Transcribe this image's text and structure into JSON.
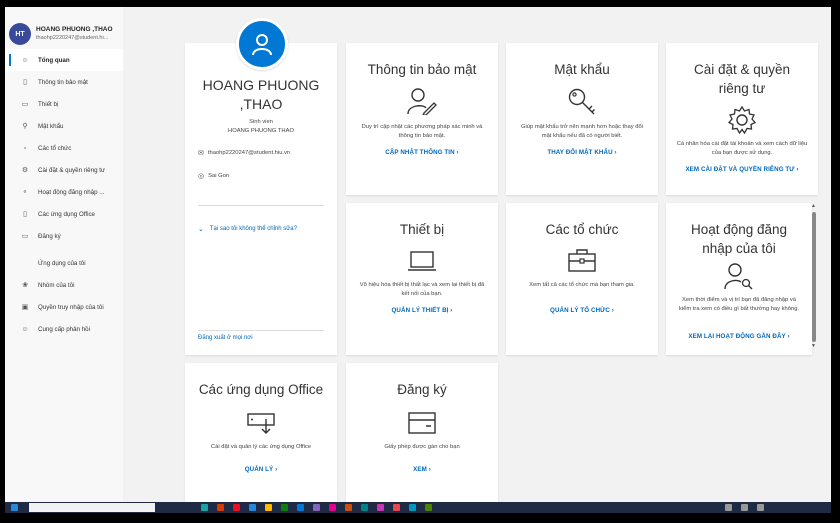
{
  "profile": {
    "avatar_initials": "HT",
    "name": "HOANG PHUONG ,THAO",
    "email_short": "thaohp2220247@student.hi...",
    "name_line1": "HOANG PHUONG",
    "name_line2": ",THAO",
    "role": "Sinh vien",
    "role_name": "HOANG PHUONG THAO",
    "email": "thaohp2220247@student.hiu.vn",
    "location": "Sai Gon",
    "why_cant_edit": "Tại sao tôi không thể chỉnh sửa?",
    "sign_out_everywhere": "Đăng xuất ở mọi nơi"
  },
  "sidebar": {
    "items": [
      {
        "label": "Tổng quan",
        "icon": "person-icon",
        "active": true
      },
      {
        "label": "Thông tin bảo mật",
        "icon": "security-info-icon"
      },
      {
        "label": "Thiết bị",
        "icon": "laptop-icon"
      },
      {
        "label": "Mật khẩu",
        "icon": "key-icon"
      },
      {
        "label": "Các tổ chức",
        "icon": "briefcase-icon"
      },
      {
        "label": "Cài đặt & quyền riêng tư",
        "icon": "gear-icon"
      },
      {
        "label": "Hoạt động đăng nhập ...",
        "icon": "sign-in-activity-icon"
      },
      {
        "label": "Các ứng dụng Office",
        "icon": "office-icon"
      },
      {
        "label": "Đăng ký",
        "icon": "subscription-icon"
      }
    ],
    "secondary": [
      {
        "label": "Ứng dụng của tôi",
        "icon": ""
      },
      {
        "label": "Nhóm của tôi",
        "icon": "groups-icon"
      },
      {
        "label": "Quyền truy nhập của tôi",
        "icon": "access-icon"
      },
      {
        "label": "Cung cấp phản hồi",
        "icon": "feedback-icon"
      }
    ]
  },
  "cards": {
    "security": {
      "title": "Thông tin bảo mật",
      "desc": "Duy trì cập nhật các phương pháp xác minh và thông tin bảo mật.",
      "link": "CẬP NHẬT THÔNG TIN"
    },
    "password": {
      "title": "Mật khẩu",
      "desc": "Giúp mật khẩu trở nên mạnh hơn hoặc thay đổi mật khẩu nếu đã có người biết.",
      "link": "THAY ĐỔI MẬT KHẨU"
    },
    "privacy": {
      "title": "Cài đặt & quyền riêng tư",
      "desc": "Cá nhân hóa cài đặt tài khoản và xem cách dữ liệu của bạn được sử dụng.",
      "link": "XEM CÀI ĐẶT VÀ QUYỀN RIÊNG TƯ"
    },
    "devices": {
      "title": "Thiết bị",
      "desc": "Vô hiệu hóa thiết bị thất lạc và xem lại thiết bị đã kết nối của bạn.",
      "link": "QUẢN LÝ THIẾT BỊ"
    },
    "orgs": {
      "title": "Các tổ chức",
      "desc": "Xem tất cả các tổ chức mà bạn tham gia.",
      "link": "QUẢN LÝ TỔ CHỨC"
    },
    "signin": {
      "title": "Hoạt động đăng nhập của tôi",
      "desc": "Xem thời điểm và vị trí bạn đã đăng nhập và kiểm tra xem có điều gì bất thường hay không.",
      "link": "XEM LẠI HOẠT ĐỘNG GẦN ĐÂY"
    },
    "office": {
      "title": "Các ứng dụng Office",
      "desc": "Cài đặt và quản lý các ứng dụng Office",
      "link": "QUẢN LÝ"
    },
    "subs": {
      "title": "Đăng ký",
      "desc": "Giấy phép được gán cho bạn",
      "link": "XEM"
    }
  },
  "chevron": "›",
  "colors": {
    "accent": "#0078d4",
    "link": "#0067b8",
    "avatar_small": "#3a4a9a",
    "taskbar": "#1f2a44"
  }
}
